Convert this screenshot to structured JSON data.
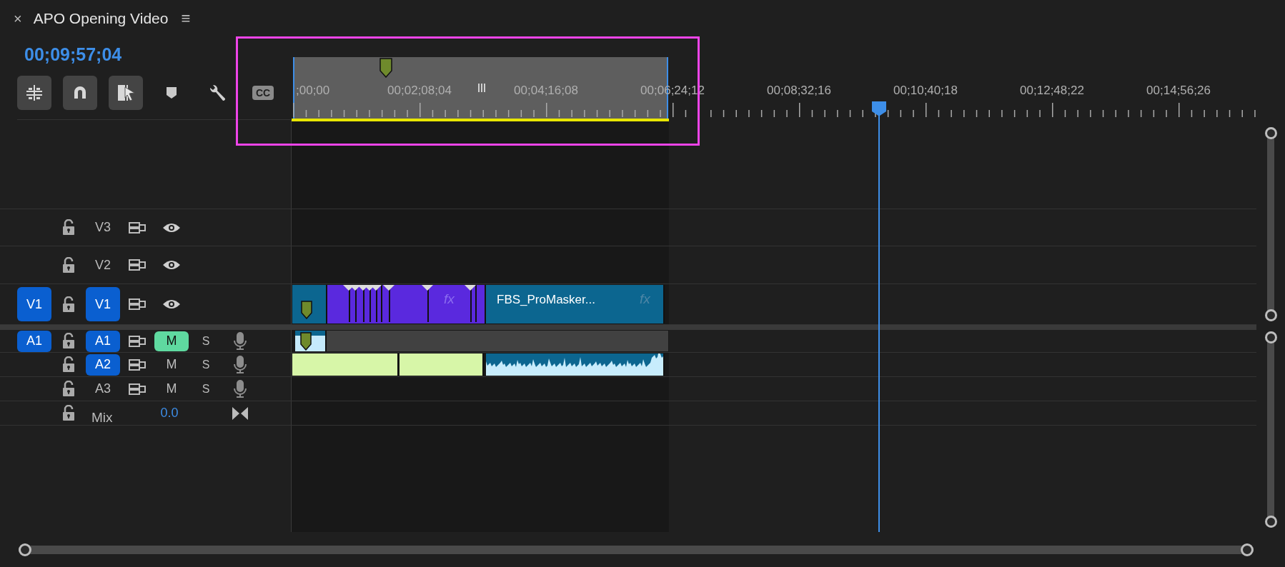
{
  "panel": {
    "close": "×",
    "title": "APO Opening Video",
    "menu": "≡"
  },
  "timecode": "00;09;57;04",
  "toolbar": [
    {
      "kind": "nest",
      "on": true
    },
    {
      "kind": "snap",
      "on": true
    },
    {
      "kind": "linked",
      "on": true
    },
    {
      "kind": "marker",
      "on": false
    },
    {
      "kind": "settings",
      "on": false
    },
    {
      "kind": "captions",
      "on": false,
      "label": "CC"
    }
  ],
  "ruler": {
    "labels": [
      ";00;00",
      "00;02;08;04",
      "00;04;16;08",
      "00;06;24;12",
      "00;08;32;16",
      "00;10;40;18",
      "00;12;48;22",
      "00;14;56;26"
    ]
  },
  "tracks": [
    {
      "kind": "video",
      "label": "V3",
      "targeted": false
    },
    {
      "kind": "video",
      "label": "V2",
      "targeted": false
    },
    {
      "kind": "video",
      "label": "V1",
      "source_patch": "V1",
      "targeted": true,
      "clips": [
        {
          "kind": "video",
          "color": "#0c6690"
        },
        {
          "kind": "video",
          "color": "#5a29de",
          "fx": "fx"
        },
        {
          "kind": "video",
          "color": "#0c6690",
          "name": "FBS_ProMasker...",
          "fx": "fx"
        }
      ]
    },
    {
      "kind": "audio",
      "label": "A1",
      "source_patch": "A1",
      "targeted": true,
      "mute": "M",
      "muted": true,
      "solo": "S",
      "clips": [
        {
          "kind": "audio",
          "color": "#c5eafc"
        },
        {
          "kind": "empty",
          "color": "#414141"
        }
      ]
    },
    {
      "kind": "audio",
      "label": "A2",
      "targeted": true,
      "mute": "M",
      "muted": false,
      "solo": "S",
      "clips": [
        {
          "kind": "audio",
          "color": "#d7f6a8"
        },
        {
          "kind": "audio",
          "color": "#d7f6a8"
        },
        {
          "kind": "waveform",
          "color": "#0c6690"
        }
      ]
    },
    {
      "kind": "audio",
      "label": "A3",
      "targeted": false,
      "mute": "M",
      "muted": false,
      "solo": "S"
    },
    {
      "kind": "mix",
      "label": "Mix",
      "value": "0.0"
    }
  ],
  "highlight": {
    "kind": "box"
  }
}
